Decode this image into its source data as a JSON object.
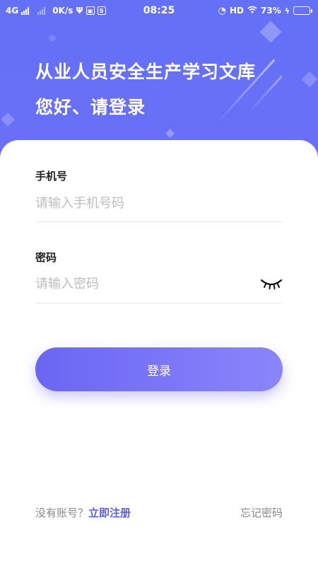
{
  "status_bar": {
    "network": "4G",
    "speed": "0K/s",
    "time": "08:25",
    "hd": "HD",
    "battery": "73%",
    "battery_level": 0.73
  },
  "header": {
    "title": "从业人员安全生产学习文库",
    "subtitle": "您好、请登录"
  },
  "form": {
    "phone_label": "手机号",
    "phone_placeholder": "请输入手机号码",
    "password_label": "密码",
    "password_placeholder": "请输入密码",
    "password_toggle_icon": "eye-closed-icon",
    "login_button": "登录"
  },
  "footer": {
    "no_account": "没有账号？",
    "register": "立即注册",
    "forgot": "忘记密码"
  },
  "colors": {
    "primary": "#6470f6",
    "button_start": "#6a66f3",
    "button_end": "#8b85fb",
    "link": "#5a5ee8"
  }
}
